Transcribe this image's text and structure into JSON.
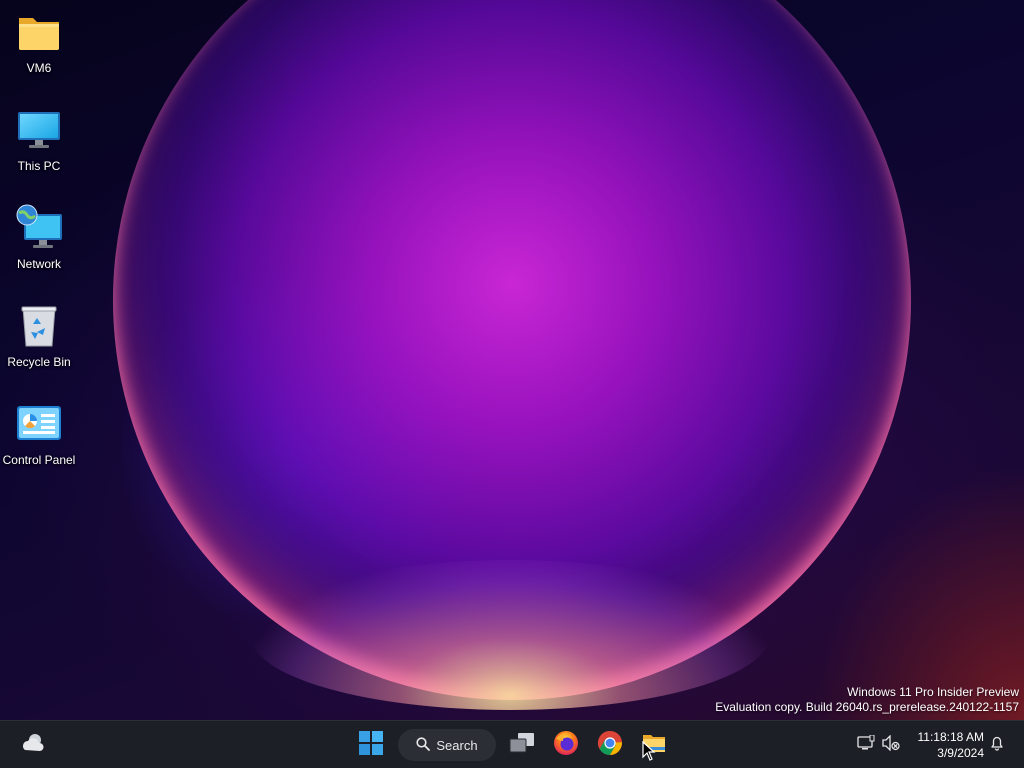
{
  "desktop": {
    "icons": [
      {
        "label": "VM6",
        "kind": "folder-icon"
      },
      {
        "label": "This PC",
        "kind": "monitor-icon"
      },
      {
        "label": "Network",
        "kind": "network-icon"
      },
      {
        "label": "Recycle Bin",
        "kind": "recycle-bin-icon"
      },
      {
        "label": "Control Panel",
        "kind": "control-panel-icon"
      }
    ],
    "watermark": {
      "line1": "Windows 11 Pro Insider Preview",
      "line2": "Evaluation copy. Build 26040.rs_prerelease.240122-1157"
    }
  },
  "taskbar": {
    "widgets_icon": "weather-cloud-icon",
    "start_icon": "windows-logo-icon",
    "search": {
      "label": "Search",
      "icon": "search-icon"
    },
    "pinned": [
      {
        "name": "task-view",
        "icon": "task-view-icon"
      },
      {
        "name": "firefox",
        "icon": "firefox-icon"
      },
      {
        "name": "chrome",
        "icon": "chrome-icon"
      },
      {
        "name": "file-explorer",
        "icon": "folder-icon"
      }
    ],
    "tray": {
      "network_icon": "network-status-icon",
      "volume_icon": "volume-muted-icon",
      "time": "11:18:18 AM",
      "date": "3/9/2024",
      "notification_icon": "bell-icon"
    }
  },
  "colors": {
    "taskbar_bg": "#1d1f26",
    "accent": "#3aa0e6"
  }
}
